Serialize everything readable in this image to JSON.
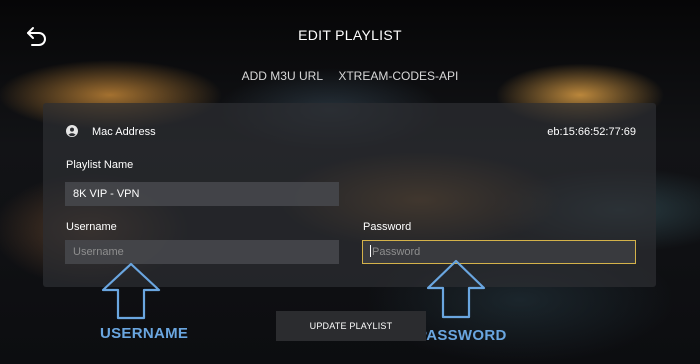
{
  "header": {
    "title": "EDIT PLAYLIST"
  },
  "tabs": [
    {
      "label": "ADD M3U URL"
    },
    {
      "label": "XTREAM-CODES-API"
    }
  ],
  "mac": {
    "label": "Mac Address",
    "value": "eb:15:66:52:77:69"
  },
  "playlist_name": {
    "label": "Playlist Name",
    "value": "8K VIP - VPN"
  },
  "username": {
    "label": "Username",
    "value": "",
    "placeholder": "Username"
  },
  "password": {
    "label": "Password",
    "value": "",
    "placeholder": "Password"
  },
  "update_button": {
    "label": "UPDATE PLAYLIST"
  },
  "annotations": {
    "username": "USERNAME",
    "password": "PASSWORD"
  },
  "colors": {
    "focus_border": "#d4b24a",
    "annotation": "#6aa6e0"
  },
  "icons": {
    "back": "back-arrow-icon",
    "mac": "account-circle-icon"
  }
}
